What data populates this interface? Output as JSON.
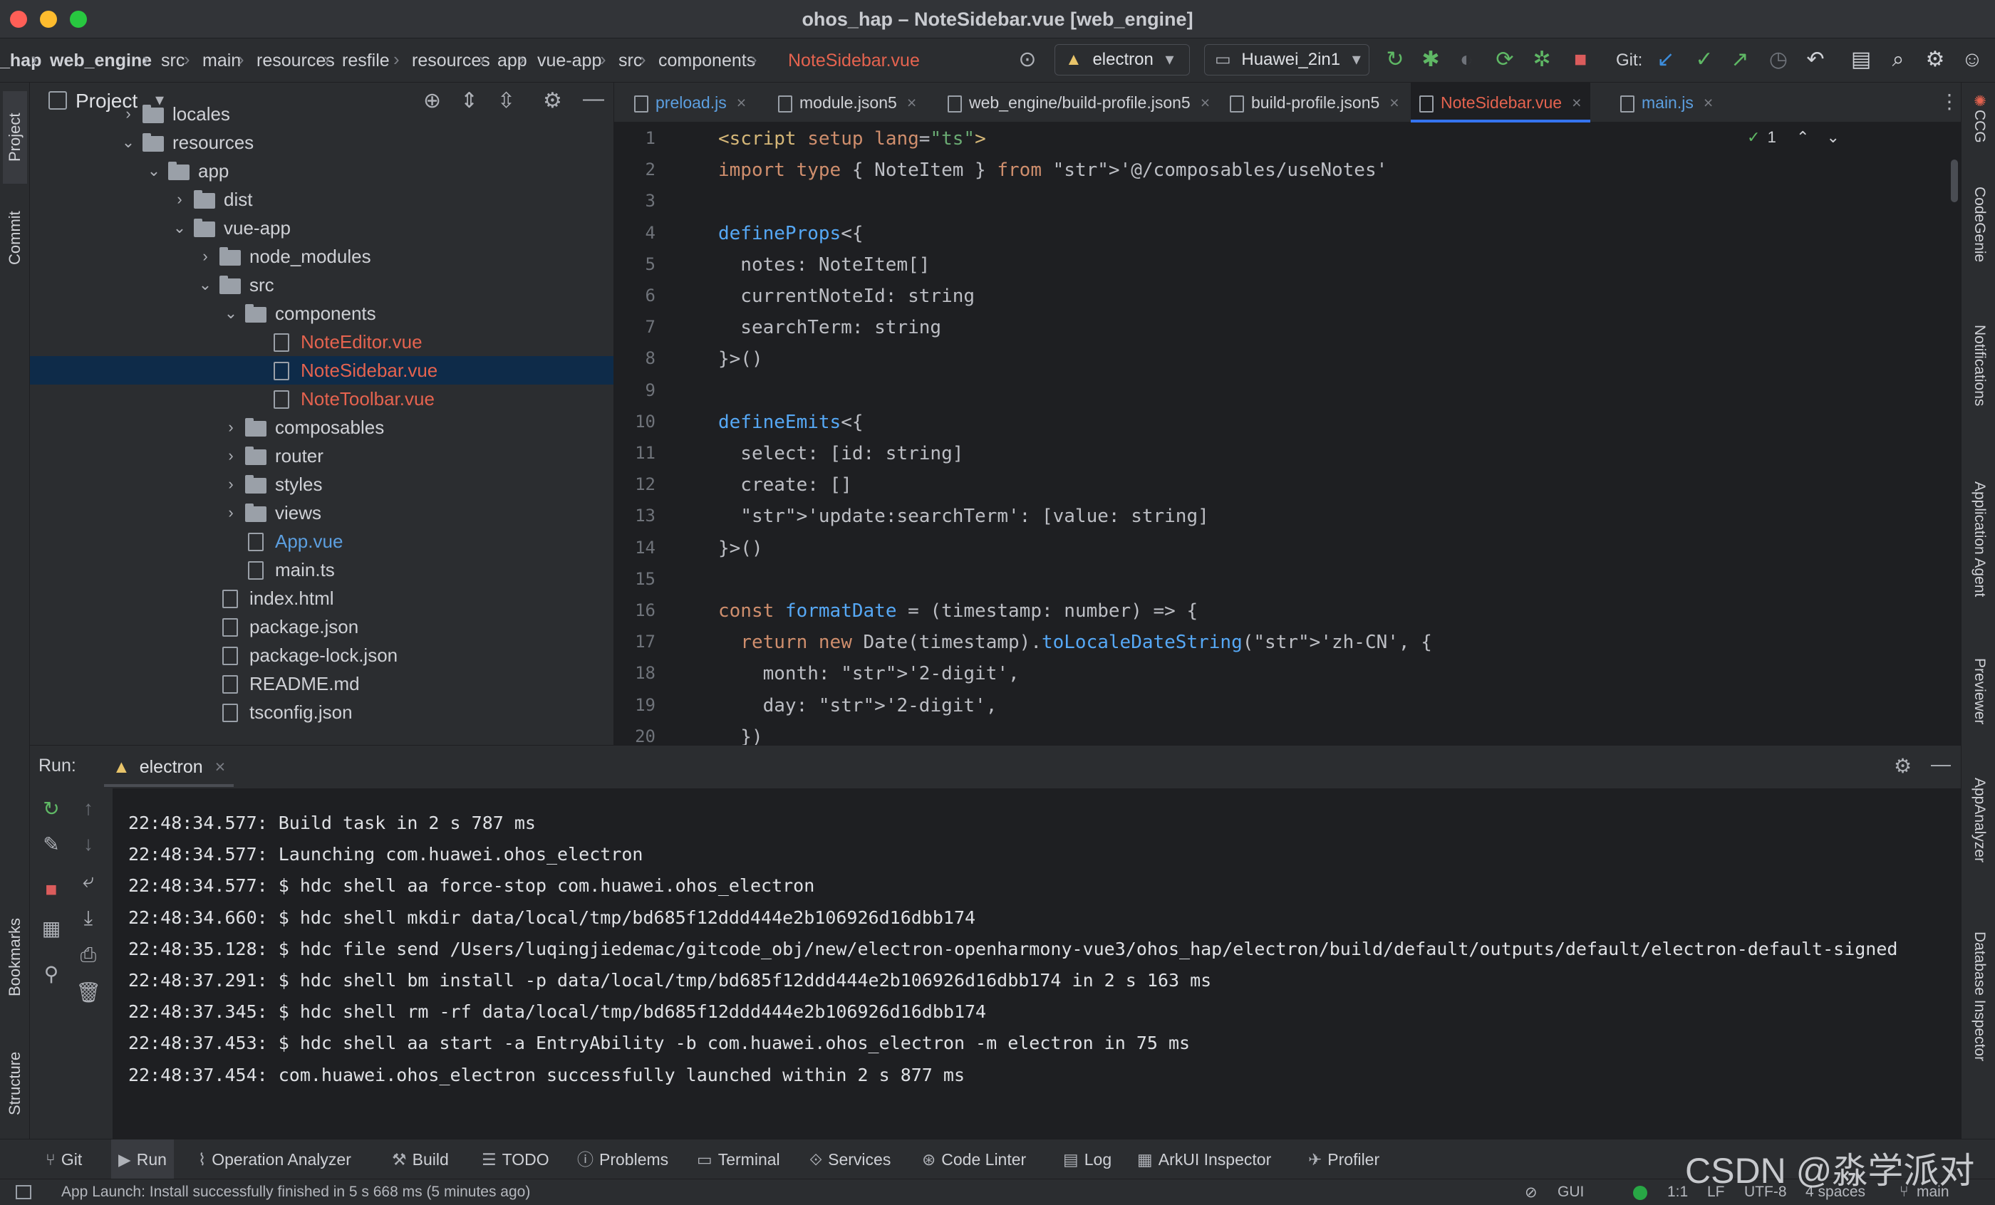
{
  "window": {
    "title": "ohos_hap – NoteSidebar.vue [web_engine]"
  },
  "toolbar": {
    "breadcrumbs": [
      "_hap",
      "web_engine",
      "src",
      "main",
      "resources",
      "resfile",
      "resources",
      "app",
      "vue-app",
      "src",
      "components",
      "NoteSidebar.vue"
    ],
    "run_config": "electron",
    "device": "Huawei_2in1",
    "git_label": "Git:"
  },
  "sidebar_left": {
    "tabs": [
      "Project",
      "Commit",
      "Bookmarks",
      "Structure"
    ]
  },
  "sidebar_right": {
    "tabs": [
      "CCG",
      "CodeGenie",
      "Notifications",
      "Application Agent",
      "Previewer",
      "AppAnalyzer",
      "Database Inspector"
    ]
  },
  "project": {
    "header": "Project",
    "tree": [
      {
        "label": "locales",
        "type": "folder",
        "depth": 0,
        "chevron": "right",
        "color": "#cfd1d6"
      },
      {
        "label": "resources",
        "type": "folder",
        "depth": 0,
        "chevron": "down",
        "color": "#cfd1d6"
      },
      {
        "label": "app",
        "type": "folder",
        "depth": 1,
        "chevron": "down",
        "color": "#cfd1d6"
      },
      {
        "label": "dist",
        "type": "folder",
        "depth": 2,
        "chevron": "right",
        "color": "#cfd1d6"
      },
      {
        "label": "vue-app",
        "type": "folder",
        "depth": 2,
        "chevron": "down",
        "color": "#cfd1d6"
      },
      {
        "label": "node_modules",
        "type": "folder",
        "depth": 3,
        "chevron": "right",
        "color": "#cfd1d6"
      },
      {
        "label": "src",
        "type": "folder",
        "depth": 3,
        "chevron": "down",
        "color": "#cfd1d6"
      },
      {
        "label": "components",
        "type": "folder",
        "depth": 4,
        "chevron": "down",
        "color": "#cfd1d6"
      },
      {
        "label": "NoteEditor.vue",
        "type": "file",
        "depth": 5,
        "chevron": "",
        "color": "#e5634f"
      },
      {
        "label": "NoteSidebar.vue",
        "type": "file",
        "depth": 5,
        "chevron": "",
        "color": "#e5634f",
        "selected": true
      },
      {
        "label": "NoteToolbar.vue",
        "type": "file",
        "depth": 5,
        "chevron": "",
        "color": "#e5634f"
      },
      {
        "label": "composables",
        "type": "folder",
        "depth": 4,
        "chevron": "right",
        "color": "#cfd1d6"
      },
      {
        "label": "router",
        "type": "folder",
        "depth": 4,
        "chevron": "right",
        "color": "#cfd1d6"
      },
      {
        "label": "styles",
        "type": "folder",
        "depth": 4,
        "chevron": "right",
        "color": "#cfd1d6"
      },
      {
        "label": "views",
        "type": "folder",
        "depth": 4,
        "chevron": "right",
        "color": "#cfd1d6"
      },
      {
        "label": "App.vue",
        "type": "file",
        "depth": 4,
        "chevron": "",
        "color": "#5c9fe0"
      },
      {
        "label": "main.ts",
        "type": "file",
        "depth": 4,
        "chevron": "",
        "color": "#cfd1d6"
      },
      {
        "label": "index.html",
        "type": "file",
        "depth": 3,
        "chevron": "",
        "color": "#cfd1d6"
      },
      {
        "label": "package.json",
        "type": "file",
        "depth": 3,
        "chevron": "",
        "color": "#cfd1d6"
      },
      {
        "label": "package-lock.json",
        "type": "file",
        "depth": 3,
        "chevron": "",
        "color": "#cfd1d6"
      },
      {
        "label": "README.md",
        "type": "file",
        "depth": 3,
        "chevron": "",
        "color": "#cfd1d6"
      },
      {
        "label": "tsconfig.json",
        "type": "file",
        "depth": 3,
        "chevron": "",
        "color": "#cfd1d6"
      }
    ]
  },
  "editor": {
    "tabs": [
      {
        "label": "preload.js",
        "color": "#5c9fe0",
        "active": false
      },
      {
        "label": "module.json5",
        "color": "#cfd1d6",
        "active": false
      },
      {
        "label": "web_engine/build-profile.json5",
        "color": "#cfd1d6",
        "active": false
      },
      {
        "label": "build-profile.json5",
        "color": "#cfd1d6",
        "active": false
      },
      {
        "label": "NoteSidebar.vue",
        "color": "#e5634f",
        "active": true
      },
      {
        "label": "main.js",
        "color": "#5c9fe0",
        "active": false
      }
    ],
    "inspection_count": "1",
    "lines": [
      "<script setup lang=\"ts\">",
      "import type { NoteItem } from '@/composables/useNotes'",
      "",
      "defineProps<{",
      "  notes: NoteItem[]",
      "  currentNoteId: string",
      "  searchTerm: string",
      "}>()",
      "",
      "defineEmits<{",
      "  select: [id: string]",
      "  create: []",
      "  'update:searchTerm': [value: string]",
      "}>()",
      "",
      "const formatDate = (timestamp: number) => {",
      "  return new Date(timestamp).toLocaleDateString('zh-CN', {",
      "    month: '2-digit',",
      "    day: '2-digit',",
      "  })"
    ]
  },
  "run": {
    "label": "Run:",
    "tab": "electron",
    "console": [
      "22:48:34.577: Build task in 2 s 787 ms",
      "22:48:34.577: Launching com.huawei.ohos_electron",
      "22:48:34.577: $ hdc shell aa force-stop com.huawei.ohos_electron",
      "22:48:34.660: $ hdc shell mkdir data/local/tmp/bd685f12ddd444e2b106926d16dbb174",
      "22:48:35.128: $ hdc file send /Users/luqingjiedemac/gitcode_obj/new/electron-openharmony-vue3/ohos_hap/electron/build/default/outputs/default/electron-default-signed",
      "22:48:37.291: $ hdc shell bm install -p data/local/tmp/bd685f12ddd444e2b106926d16dbb174 in 2 s 163 ms",
      "22:48:37.345: $ hdc shell rm -rf data/local/tmp/bd685f12ddd444e2b106926d16dbb174",
      "22:48:37.453: $ hdc shell aa start -a EntryAbility -b com.huawei.ohos_electron -m electron in 75 ms",
      "22:48:37.454: com.huawei.ohos_electron successfully launched within 2 s 877 ms"
    ]
  },
  "bottom_tools": [
    {
      "label": "Git",
      "icon": "git-branch-icon"
    },
    {
      "label": "Run",
      "icon": "run-icon",
      "active": true
    },
    {
      "label": "Operation Analyzer",
      "icon": "chart-icon"
    },
    {
      "label": "Build",
      "icon": "hammer-icon"
    },
    {
      "label": "TODO",
      "icon": "list-icon"
    },
    {
      "label": "Problems",
      "icon": "info-icon"
    },
    {
      "label": "Terminal",
      "icon": "terminal-icon"
    },
    {
      "label": "Services",
      "icon": "services-icon"
    },
    {
      "label": "Code Linter",
      "icon": "linter-icon"
    },
    {
      "label": "Log",
      "icon": "log-icon"
    },
    {
      "label": "ArkUI Inspector",
      "icon": "inspector-icon"
    },
    {
      "label": "Profiler",
      "icon": "profiler-icon"
    }
  ],
  "status": {
    "message": "App Launch: Install successfully finished in 5 s 668 ms (5 minutes ago)",
    "gui": "GUI",
    "position": "1:1",
    "line_sep": "LF",
    "encoding": "UTF-8",
    "indent": "4 spaces",
    "branch": "main"
  },
  "watermark": "CSDN @淼学派对"
}
